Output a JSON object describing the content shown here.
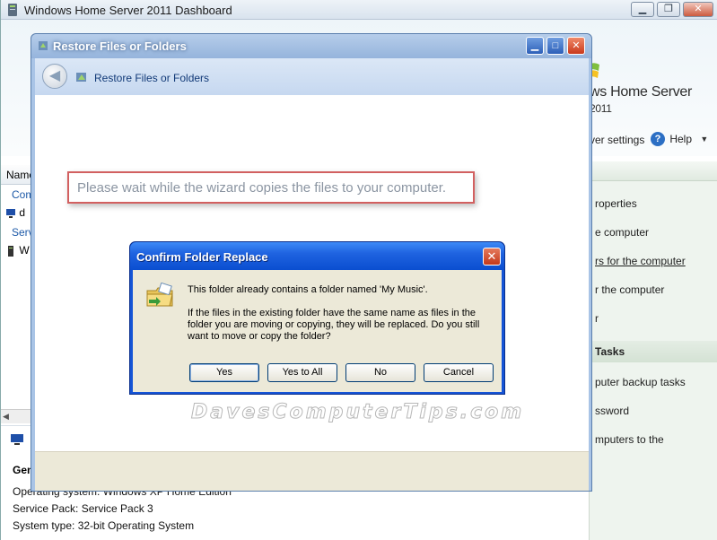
{
  "dashboard": {
    "title": "Windows Home Server 2011 Dashboard",
    "brand": "ws Home Server",
    "brand_year": "2011",
    "server_settings_label": "ver settings",
    "help_label": "Help",
    "list_column_header": "Name",
    "list_rows": [
      {
        "text": "Com",
        "kind": "group"
      },
      {
        "text": "d",
        "kind": "item"
      },
      {
        "text": "Serv",
        "kind": "group"
      },
      {
        "text": "W",
        "kind": "item"
      }
    ],
    "details": {
      "heading": "Gen",
      "lines": [
        "Operating system: Windows XP Home Edition",
        "Service Pack: Service Pack 3",
        "System type: 32-bit Operating System"
      ]
    },
    "tasks": {
      "items": [
        {
          "label": "roperties",
          "link": false
        },
        {
          "label": "e computer",
          "link": false
        },
        {
          "label": "rs for the computer",
          "link": true
        },
        {
          "label": "r the computer",
          "link": false
        },
        {
          "label": "r",
          "link": false
        }
      ],
      "section_heading": "Tasks",
      "items2": [
        {
          "label": "puter backup tasks"
        },
        {
          "label": "ssword"
        },
        {
          "label": "mputers to the"
        }
      ]
    },
    "watermark": "DavesComputerTips.com"
  },
  "wizard": {
    "title": "Restore Files or Folders",
    "nav_title": "Restore Files or Folders",
    "status_message": "Please wait while the wizard copies the files to your computer."
  },
  "dialog": {
    "title": "Confirm Folder Replace",
    "message_line1": "This folder already contains a folder named 'My Music'.",
    "message_line2": "If the files in the existing folder have the same name as files in the folder you are moving or copying, they will be replaced.  Do you still want to move or copy the folder?",
    "buttons": {
      "yes": "Yes",
      "yes_to_all": "Yes to All",
      "no": "No",
      "cancel": "Cancel"
    }
  },
  "icons": {
    "dashboard_app": "server-icon",
    "wizard_app": "restore-icon",
    "dialog": "folder-move-icon",
    "back": "back-arrow-icon",
    "help": "help-icon"
  },
  "colors": {
    "xp_title_blue": "#1f63e0",
    "close_red": "#c9391c",
    "dialog_face": "#ece9d8",
    "wait_box_border": "#d26060"
  }
}
